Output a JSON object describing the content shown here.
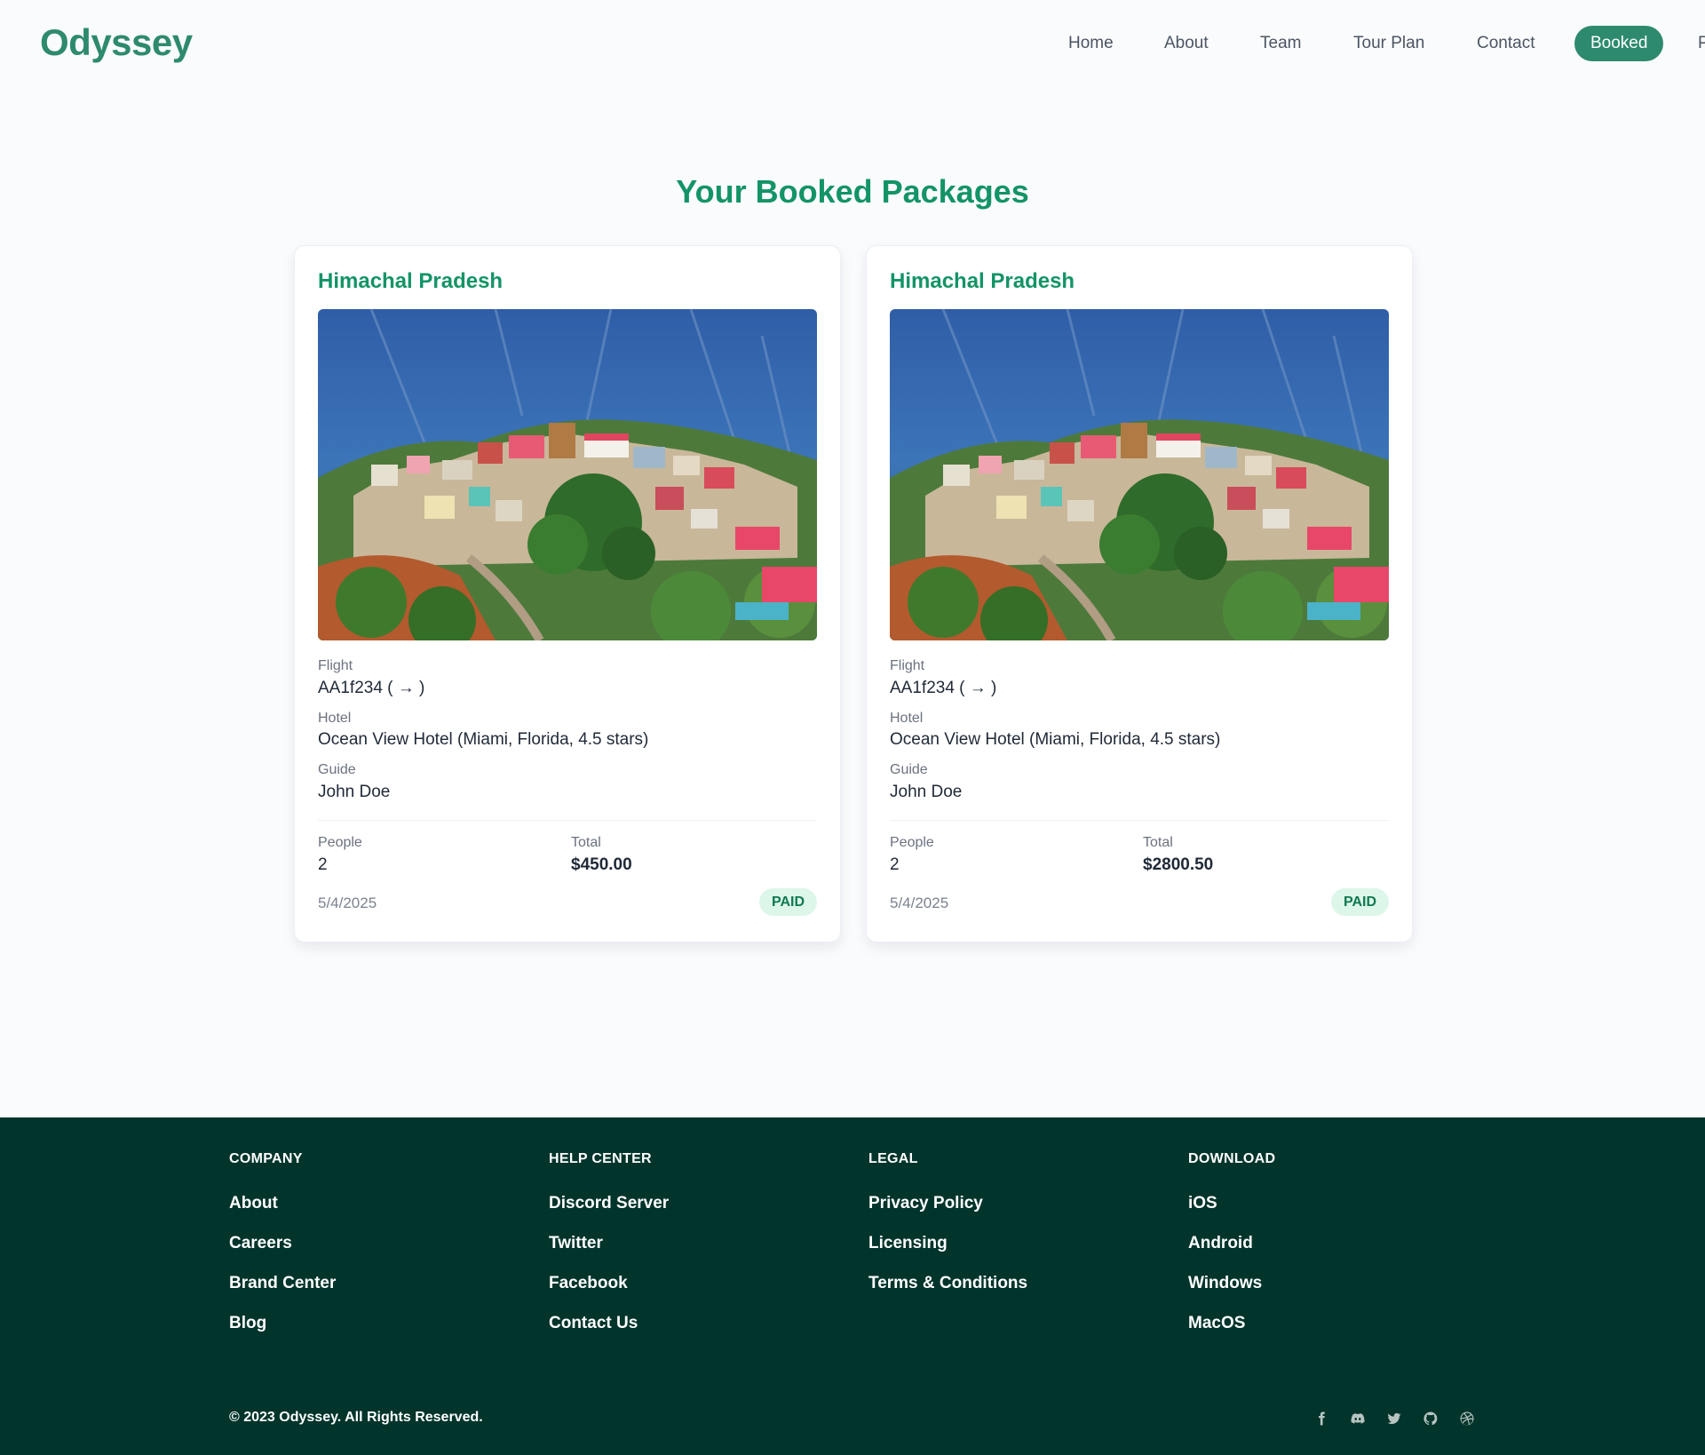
{
  "header": {
    "logo": "Odyssey",
    "nav": [
      {
        "label": "Home",
        "active": false
      },
      {
        "label": "About",
        "active": false
      },
      {
        "label": "Team",
        "active": false
      },
      {
        "label": "Tour Plan",
        "active": false
      },
      {
        "label": "Contact",
        "active": false
      },
      {
        "label": "Booked",
        "active": true
      },
      {
        "label": "Profile",
        "active": false
      }
    ]
  },
  "main": {
    "title": "Your Booked Packages",
    "bookings": [
      {
        "destination": "Himachal Pradesh",
        "image_icon": "mountain-village-photo",
        "flight_label": "Flight",
        "flight": "AA1f234 ( → )",
        "hotel_label": "Hotel",
        "hotel": "Ocean View Hotel (Miami, Florida, 4.5 stars)",
        "guide_label": "Guide",
        "guide": "John Doe",
        "people_label": "People",
        "people": "2",
        "total_label": "Total",
        "total": "$450.00",
        "date": "5/4/2025",
        "status": "PAID"
      },
      {
        "destination": "Himachal Pradesh",
        "image_icon": "mountain-village-photo",
        "flight_label": "Flight",
        "flight": "AA1f234 ( → )",
        "hotel_label": "Hotel",
        "hotel": "Ocean View Hotel (Miami, Florida, 4.5 stars)",
        "guide_label": "Guide",
        "guide": "John Doe",
        "people_label": "People",
        "people": "2",
        "total_label": "Total",
        "total": "$2800.50",
        "date": "5/4/2025",
        "status": "PAID"
      }
    ]
  },
  "footer": {
    "columns": [
      {
        "heading": "COMPANY",
        "links": [
          "About",
          "Careers",
          "Brand Center",
          "Blog"
        ]
      },
      {
        "heading": "HELP CENTER",
        "links": [
          "Discord Server",
          "Twitter",
          "Facebook",
          "Contact Us"
        ]
      },
      {
        "heading": "LEGAL",
        "links": [
          "Privacy Policy",
          "Licensing",
          "Terms & Conditions"
        ]
      },
      {
        "heading": "DOWNLOAD",
        "links": [
          "iOS",
          "Android",
          "Windows",
          "MacOS"
        ]
      }
    ],
    "copyright": "© 2023 Odyssey. All Rights Reserved.",
    "socials": [
      "facebook-icon",
      "discord-icon",
      "twitter-icon",
      "github-icon",
      "dribbble-icon"
    ]
  },
  "colors": {
    "brand": "#2e8a6e",
    "title_green": "#139466",
    "footer_bg": "#01342b",
    "badge_bg": "#ddf6ea",
    "badge_text": "#0f7a52"
  }
}
